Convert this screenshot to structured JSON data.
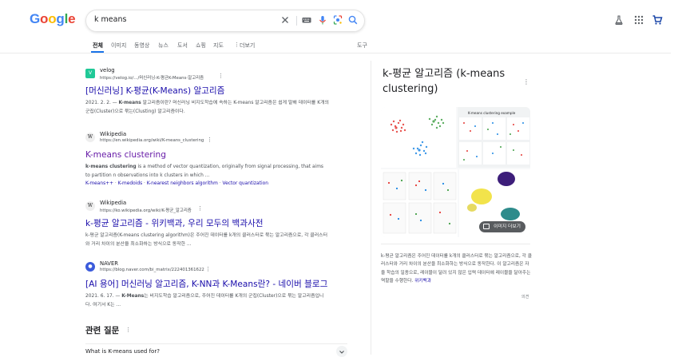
{
  "logo": "Google",
  "search": {
    "query": "k means"
  },
  "tabs": [
    "전체",
    "이미지",
    "동영상",
    "뉴스",
    "도서",
    "쇼핑",
    "지도",
    "더보기"
  ],
  "tools_label": "도구",
  "results": [
    {
      "favicon": "V",
      "favicon_color": "#20c997",
      "site": "velog",
      "url": "https://velog.io/.../머신러닝-K-평균K-Means-알고리즘",
      "title": "[머신러닝] K-평균(K-Means) 알고리즘",
      "snippet_pre": "2021. 2. 2. — ",
      "snippet_bold": "K-means",
      "snippet_post": " 알고리즘이란? 머신러닝 비지도학습에 속하는 K-means 알고리즘은 쉽게 말해 데이터를 K개의 군집(Cluster)으로 묶는(Clusting) 알고리즘이다."
    },
    {
      "favicon": "W",
      "favicon_color": "#eeeeee",
      "site": "Wikipedia",
      "url": "https://en.wikipedia.org/wiki/K-means_clustering",
      "title": "K-means clustering",
      "snippet_pre": "",
      "snippet_bold": "k-means clustering",
      "snippet_post": " is a method of vector quantization, originally from signal processing, that aims to partition n observations into k clusters in which ...",
      "sublinks": [
        "K-means++",
        "K-medoids",
        "K-nearest neighbors algorithm",
        "Vector quantization"
      ]
    },
    {
      "favicon": "W",
      "favicon_color": "#eeeeee",
      "site": "Wikipedia",
      "url": "https://ko.wikipedia.org/wiki/K-평균_알고리즘",
      "title": "k-평균 알고리즘 - 위키백과, 우리 모두의 백과사전",
      "snippet_pre": "",
      "snippet_bold": "",
      "snippet_post": "k-평균 알고리즘(K-means clustering algorithm)은 주어진 데이터를 k개의 클러스터로 묶는 알고리즘으로, 각 클러스터와 거리 차이의 분산을 최소화하는 방식으로 동작한 ..."
    },
    {
      "favicon": "N",
      "favicon_color": "#3b5bdb",
      "site": "NAVER",
      "url": "https://blog.naver.com/bi_matrix/222401361622",
      "title": "[AI 용어] 머신러닝 알고리즘, K-NN과 K-Means란? - 네이버 블로그",
      "snippet_pre": "2021. 6. 17. — ",
      "snippet_bold": "K-Means",
      "snippet_post": "는 비지도학습 알고리즘으로, 주어진 데이터를 K개의 군집(Cluster)으로 묶는 알고리즘입니다. 여기서 K는 ..."
    }
  ],
  "related": {
    "title": "관련 질문",
    "first_question": "What is K-means used for?"
  },
  "knowledge_panel": {
    "title": "k-평균 알고리즘 (k-means clustering)",
    "image_caption": "K-means clustering example",
    "more_images": "이미지 더보기",
    "description": "k-평균 알고리즘은 주어진 데이터를 k개의 클러스터로 묶는 알고리즘으로, 각 클러스터와 거리 차이의 분산을 최소화하는 방식으로 동작한다. 이 알고리즘은 자율 학습의 일종으로, 레이블이 달려 있지 않은 입력 데이터에 레이블을 달아주는 역할을 수행한다.",
    "more_link": "위키백과",
    "feedback": "의견"
  },
  "colors": {
    "link": "#1a0dab",
    "visited": "#681da8",
    "accent": "#1a73e8"
  }
}
